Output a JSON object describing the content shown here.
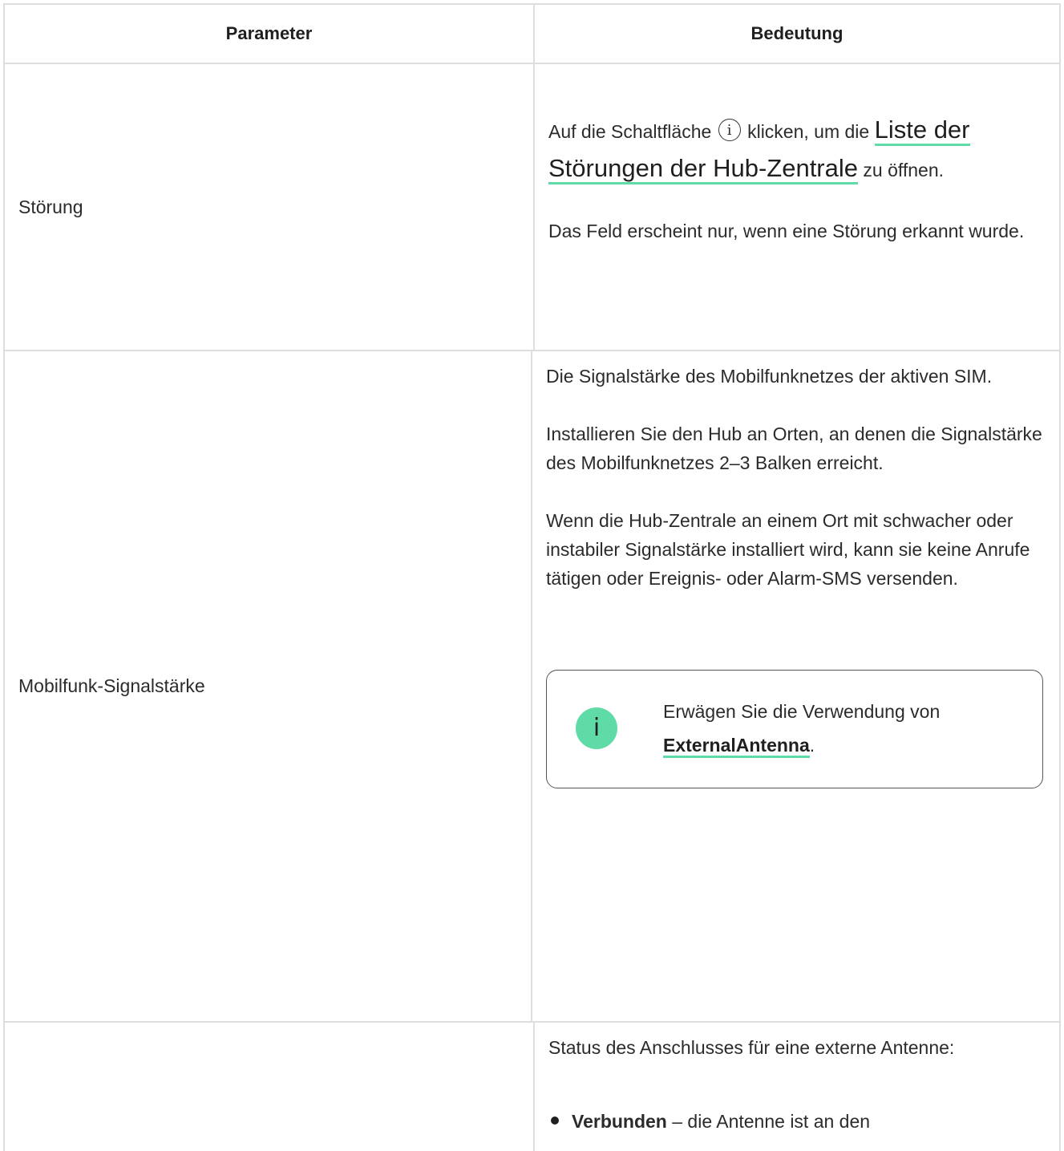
{
  "table": {
    "headers": {
      "parameter": "Parameter",
      "meaning": "Bedeutung"
    },
    "rows": [
      {
        "parameter": "Störung",
        "text_before_icon": "Auf die Schaltfläche",
        "text_after_icon": "klicken, um die",
        "link": "Liste der Störungen der Hub-Zentrale",
        "text_after_link": "zu öffnen.",
        "note": "Das Feld erscheint nur, wenn eine Störung erkannt wurde."
      },
      {
        "parameter": "Mobilfunk-Signalstärke",
        "p1": "Die Signalstärke des Mobilfunknetzes der aktiven SIM.",
        "p2": "Installieren Sie den Hub an Orten, an denen die Signalstärke des Mobilfunknetzes 2–3 Balken erreicht.",
        "p3": "Wenn die Hub-Zentrale an einem Ort mit schwacher oder instabiler Signalstärke installiert wird, kann sie keine Anrufe tätigen oder Ereignis- oder Alarm-SMS versenden.",
        "callout": {
          "icon": "info-icon",
          "text": "Erwägen Sie die Verwendung von",
          "link": "ExternalAntenna",
          "suffix": "."
        }
      },
      {
        "parameter": "",
        "p1": "Status des Anschlusses für eine externe Antenne:",
        "bullet_bold": "Verbunden",
        "bullet_text": " – die Antenne ist an den"
      }
    ]
  },
  "colors": {
    "accent": "#5fdba7",
    "border": "#dedede",
    "text": "#2b2b2b"
  }
}
